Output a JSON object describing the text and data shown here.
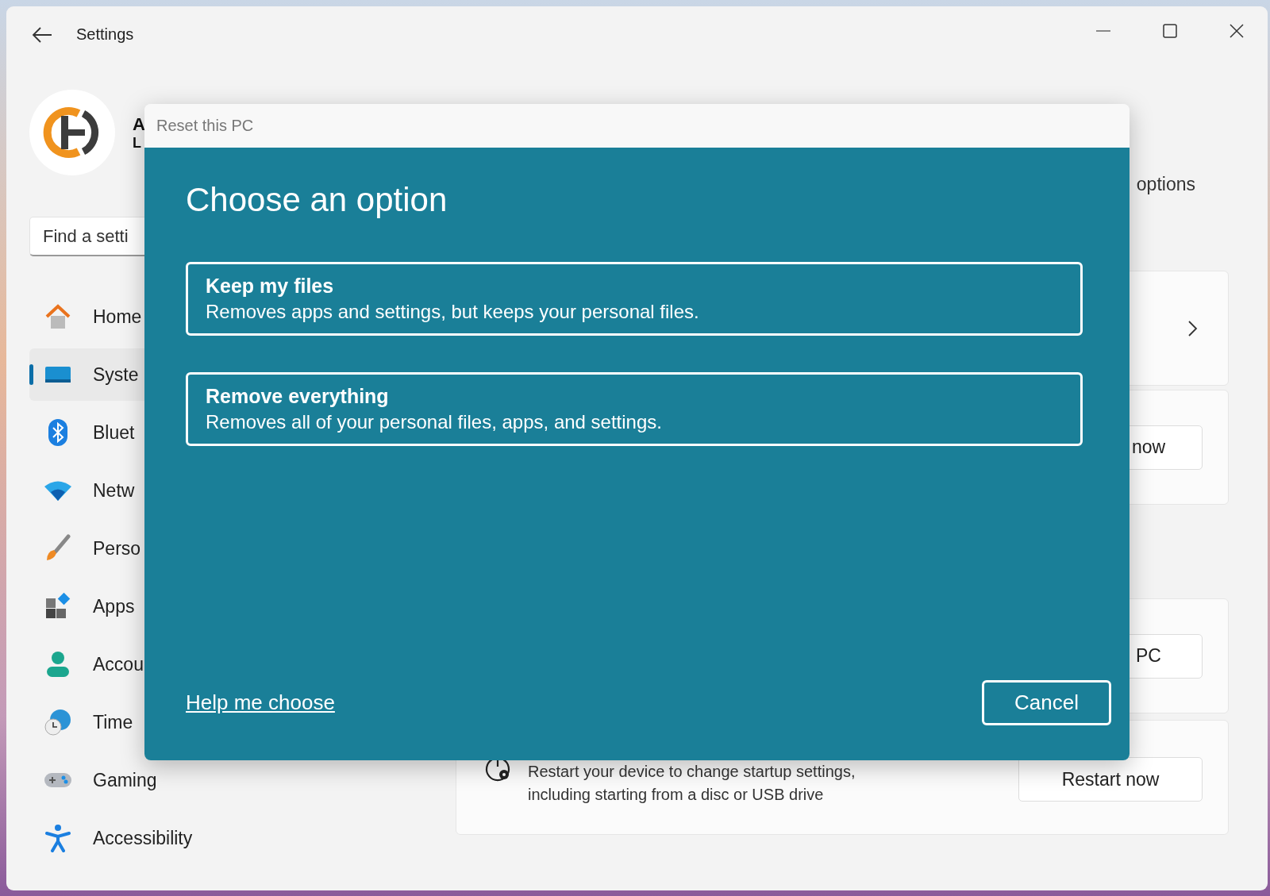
{
  "window": {
    "title": "Settings"
  },
  "profile": {
    "name": "A",
    "detail": "L"
  },
  "search": {
    "placeholder": "Find a setti"
  },
  "sidebar": {
    "items": [
      {
        "kind": "home",
        "label": "Home",
        "selected": false
      },
      {
        "kind": "system",
        "label": "Syste",
        "selected": true
      },
      {
        "kind": "bluetooth",
        "label": "Bluet",
        "selected": false
      },
      {
        "kind": "network",
        "label": "Netw",
        "selected": false
      },
      {
        "kind": "brush",
        "label": "Perso",
        "selected": false
      },
      {
        "kind": "apps",
        "label": "Apps",
        "selected": false
      },
      {
        "kind": "account",
        "label": "Accou",
        "selected": false
      },
      {
        "kind": "time",
        "label": "Time",
        "selected": false
      },
      {
        "kind": "gaming",
        "label": "Gaming",
        "selected": false
      },
      {
        "kind": "accessibility",
        "label": "Accessibility",
        "selected": false
      }
    ]
  },
  "main": {
    "heading": "options",
    "cards": [
      {
        "kind": "link"
      },
      {
        "kind": "button",
        "button": "now"
      },
      {
        "kind": "button",
        "button": "PC"
      },
      {
        "kind": "restart",
        "description": "Restart your device to change startup settings, including starting from a disc or USB drive",
        "button": "Restart now"
      }
    ]
  },
  "dialog": {
    "title": "Reset this PC",
    "heading": "Choose an option",
    "options": [
      {
        "title": "Keep my files",
        "description": "Removes apps and settings, but keeps your personal files."
      },
      {
        "title": "Remove everything",
        "description": "Removes all of your personal files, apps, and settings."
      }
    ],
    "help_link": "Help me choose",
    "cancel": "Cancel"
  }
}
